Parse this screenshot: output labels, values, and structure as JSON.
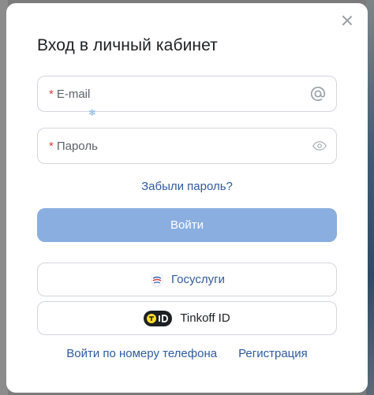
{
  "modal": {
    "title": "Вход в личный кабинет"
  },
  "email": {
    "required_mark": "*",
    "placeholder": "E-mail",
    "icon": "at-sign-icon"
  },
  "password": {
    "required_mark": "*",
    "placeholder": "Пароль",
    "icon": "eye-icon"
  },
  "forgot_link": "Забыли пароль?",
  "login_button": "Войти",
  "gosuslugi_button": "Госуслуги",
  "tinkoff_button": "Tinkoff ID",
  "phone_login_link": "Войти по номеру телефона",
  "register_link": "Регистрация",
  "colors": {
    "primary_link": "#2f5a9e",
    "login_button_bg": "#8aaedf",
    "required": "#e03c3c"
  }
}
